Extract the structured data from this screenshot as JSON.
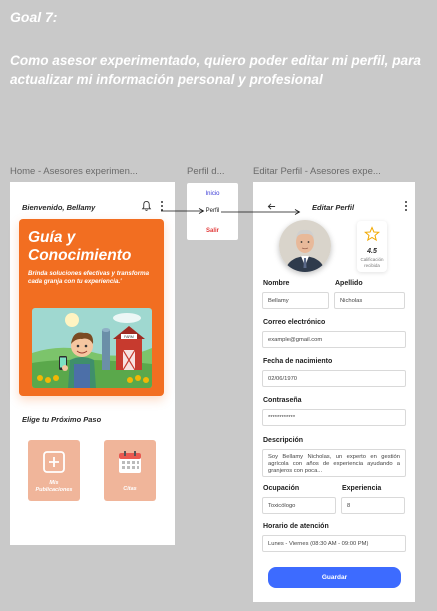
{
  "goal": {
    "title": "Goal 7:",
    "text": "Como asesor experimentado, quiero poder editar mi perfil, para actualizar mi información personal y profesional"
  },
  "frames": {
    "home_label": "Home - Asesores experimen...",
    "menu_label": "Perfil d...",
    "edit_label": "Editar Perfil - Asesores expe..."
  },
  "home": {
    "greeting": "Bienvenido, Bellamy",
    "hero_title_line1": "Guía y",
    "hero_title_line2": "Conocimiento",
    "hero_subtitle": "Brinda soluciones efectivas y transforma cada granja con tu experiencia.'",
    "barn_sign": "FARM",
    "section_title": "Elige tu Próximo Paso",
    "tiles": [
      {
        "label_line1": "Mis",
        "label_line2": "Publicaciones"
      },
      {
        "label_line1": "Citas"
      }
    ]
  },
  "menu": {
    "items": [
      "Inicio",
      "Perfil",
      "Salir"
    ],
    "colors": {
      "inicio": "#3b3bd6",
      "salir": "#e23b3b"
    }
  },
  "edit": {
    "title": "Editar Perfil",
    "rating": {
      "value": "4.5",
      "label_line1": "Calificación",
      "label_line2": "recibida"
    },
    "fields": {
      "nombre": {
        "label": "Nombre",
        "value": "Bellamy"
      },
      "apellido": {
        "label": "Apellido",
        "value": "Nicholas"
      },
      "correo": {
        "label": "Correo electrónico",
        "value": "example@gmail.com"
      },
      "nacimiento": {
        "label": "Fecha de nacimiento",
        "value": "02/06/1970"
      },
      "contrasena": {
        "label": "Contraseña",
        "value": "************"
      },
      "descripcion": {
        "label": "Descripción",
        "value": "Soy Bellamy Nicholas, un experto en gestión agrícola con años de experiencia ayudando a granjeros con poca..."
      },
      "ocupacion": {
        "label": "Ocupación",
        "value": "Toxicólogo"
      },
      "experiencia": {
        "label": "Experiencia",
        "value": "8"
      },
      "horario": {
        "label": "Horario de atención",
        "value": "Lunes - Viernes (08:30 AM - 09:00 PM)"
      }
    },
    "save_label": "Guardar",
    "accent": "#3d6bff"
  },
  "icons": [
    "bell-icon",
    "more-vertical-icon",
    "back-arrow-icon",
    "star-icon",
    "plus-square-icon",
    "calendar-icon"
  ],
  "brand_color": "#f26e21"
}
